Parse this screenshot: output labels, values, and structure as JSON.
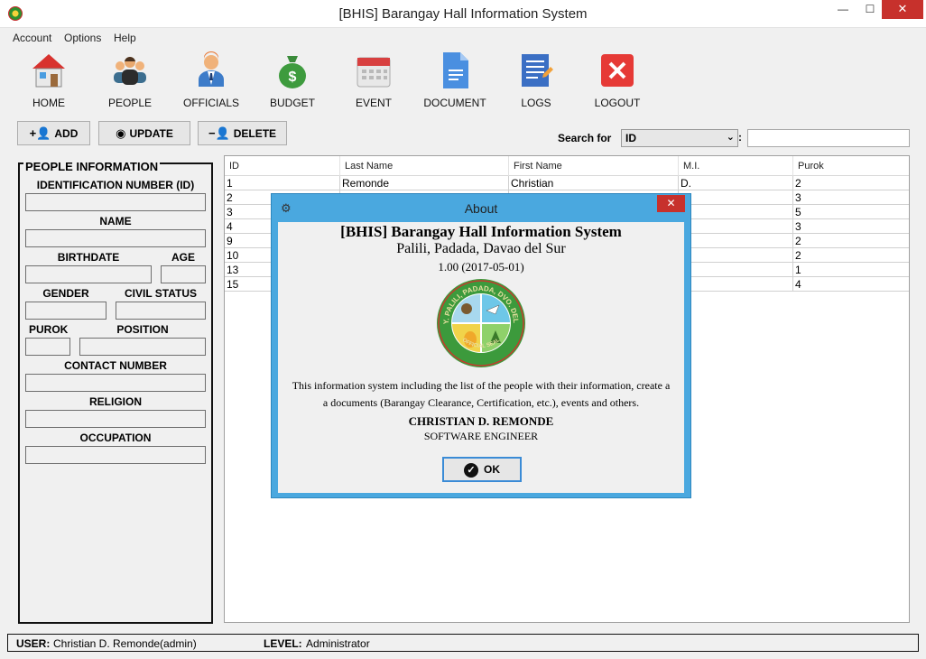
{
  "window": {
    "title": "[BHIS] Barangay Hall Information System",
    "min": "—",
    "max": "☐",
    "close": "✕"
  },
  "menu": [
    "Account",
    "Options",
    "Help"
  ],
  "toolbar": [
    {
      "label": "HOME",
      "icon": "home-icon"
    },
    {
      "label": "PEOPLE",
      "icon": "people-icon"
    },
    {
      "label": "OFFICIALS",
      "icon": "official-icon"
    },
    {
      "label": "BUDGET",
      "icon": "money-bag-icon"
    },
    {
      "label": "EVENT",
      "icon": "calendar-icon"
    },
    {
      "label": "DOCUMENT",
      "icon": "document-icon"
    },
    {
      "label": "LOGS",
      "icon": "logs-icon"
    },
    {
      "label": "LOGOUT",
      "icon": "logout-icon"
    }
  ],
  "actions": {
    "add": "ADD",
    "update": "UPDATE",
    "delete": "DELETE"
  },
  "search": {
    "label": "Search for",
    "field": "ID",
    "colon": ":",
    "value": ""
  },
  "people_form": {
    "legend": "PEOPLE INFORMATION",
    "id_label": "IDENTIFICATION NUMBER (ID)",
    "name_label": "NAME",
    "birthdate_label": "BIRTHDATE",
    "age_label": "AGE",
    "gender_label": "GENDER",
    "civil_label": "CIVIL STATUS",
    "purok_label": "PUROK",
    "position_label": "POSITION",
    "contact_label": "CONTACT NUMBER",
    "religion_label": "RELIGION",
    "occupation_label": "OCCUPATION"
  },
  "table": {
    "columns": [
      "ID",
      "Last Name",
      "First Name",
      "M.I.",
      "Purok"
    ],
    "rows": [
      [
        "1",
        "Remonde",
        "Christian",
        "D.",
        "2"
      ],
      [
        "2",
        "",
        "",
        "",
        "3"
      ],
      [
        "3",
        "",
        "",
        "",
        "5"
      ],
      [
        "4",
        "",
        "",
        "",
        "3"
      ],
      [
        "9",
        "",
        "",
        "",
        "2"
      ],
      [
        "10",
        "",
        "",
        "",
        "2"
      ],
      [
        "13",
        "",
        "",
        "",
        "1"
      ],
      [
        "15",
        "",
        "",
        "",
        "4"
      ]
    ]
  },
  "status": {
    "user_label": "USER:",
    "user": "Christian D. Remonde(admin)",
    "level_label": "LEVEL:",
    "level": "Administrator"
  },
  "about": {
    "title": "About",
    "close": "✕",
    "app": "[BHIS] Barangay Hall Information System",
    "place": "Palili, Padada, Davao del Sur",
    "version": "1.00 (2017-05-01)",
    "description": "This information system including the list of the people with their information, create a a documents (Barangay Clearance, Certification, etc.), events and others.",
    "author": "CHRISTIAN D. REMONDE",
    "role": "SOFTWARE ENGINEER",
    "ok": "OK",
    "seal_text": "BRGY. PALILI, PADADA, DVO. DEL SUR",
    "seal_bottom": "OFFICIAL SEAL"
  }
}
